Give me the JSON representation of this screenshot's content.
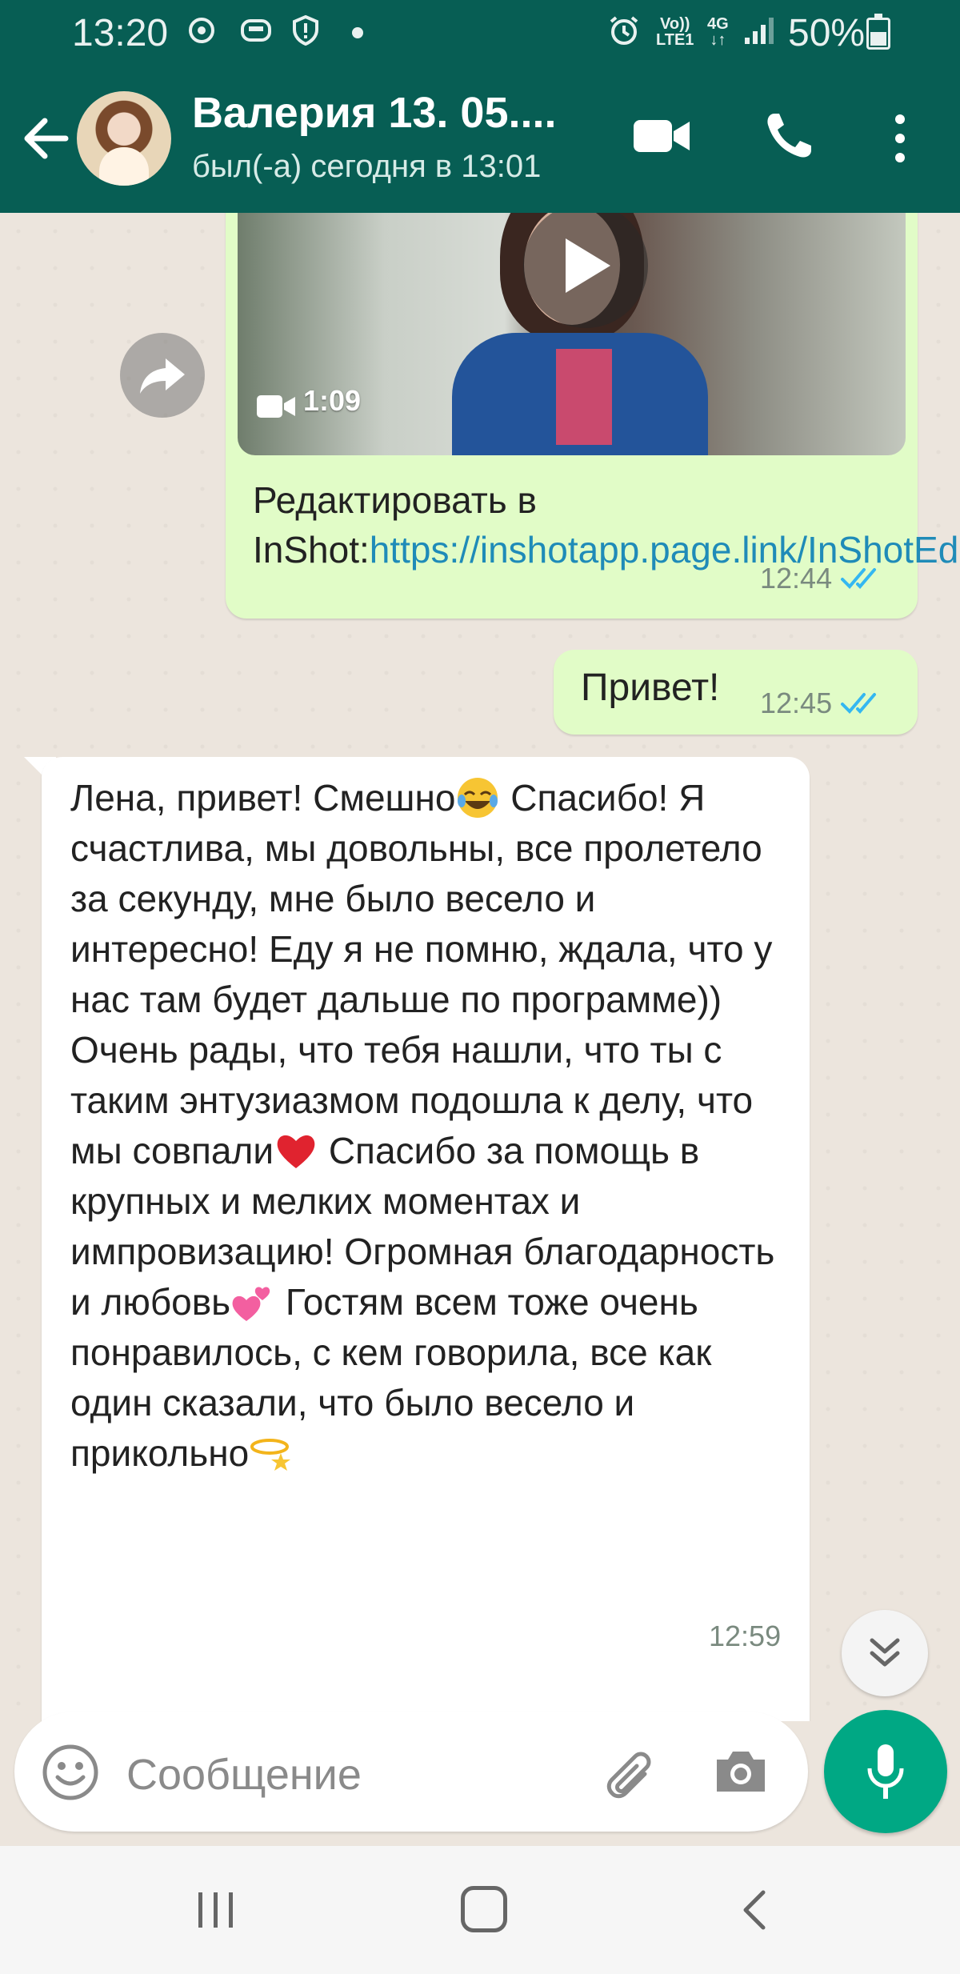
{
  "status_bar": {
    "time": "13:20",
    "net_volte": "Vo))",
    "net_lte": "LTE1",
    "net_4g": "4G",
    "battery": "50%"
  },
  "header": {
    "contact_name": "Валерия 13. 05....",
    "contact_status": "был(-а) сегодня в 13:01"
  },
  "messages": {
    "video": {
      "duration": "1:09",
      "caption_prefix": "Редактировать в InShot:",
      "caption_link": "https://inshotapp.page.link/InShotEditor",
      "time": "12:44"
    },
    "hello": {
      "text": "Привет!",
      "time": "12:45"
    },
    "reply": {
      "part1": "Лена, привет! Смешно",
      "part2": " Спасибо! Я счастлива, мы довольны, все пролетело за секунду, мне было весело и интересно! Еду я не помню, ждала, что у нас там будет дальше по программе)) Очень рады, что тебя нашли, что ты с таким энтузиазмом подошла к делу, что мы совпали",
      "part3": " Спасибо за помощь в крупных и мелких моментах и импровизацию! Огромная благодарность и любовь",
      "part4": " Гостям всем тоже очень понравилось, с кем говорила, все как один сказали, что было весело и прикольно",
      "time": "12:59"
    }
  },
  "composer": {
    "placeholder": "Сообщение"
  },
  "colors": {
    "header": "#075e54",
    "outgoing": "#e1fcc7",
    "incoming": "#ffffff",
    "mic": "#00a884",
    "read_ticks": "#34b7f1",
    "link": "#1f8bb8"
  }
}
